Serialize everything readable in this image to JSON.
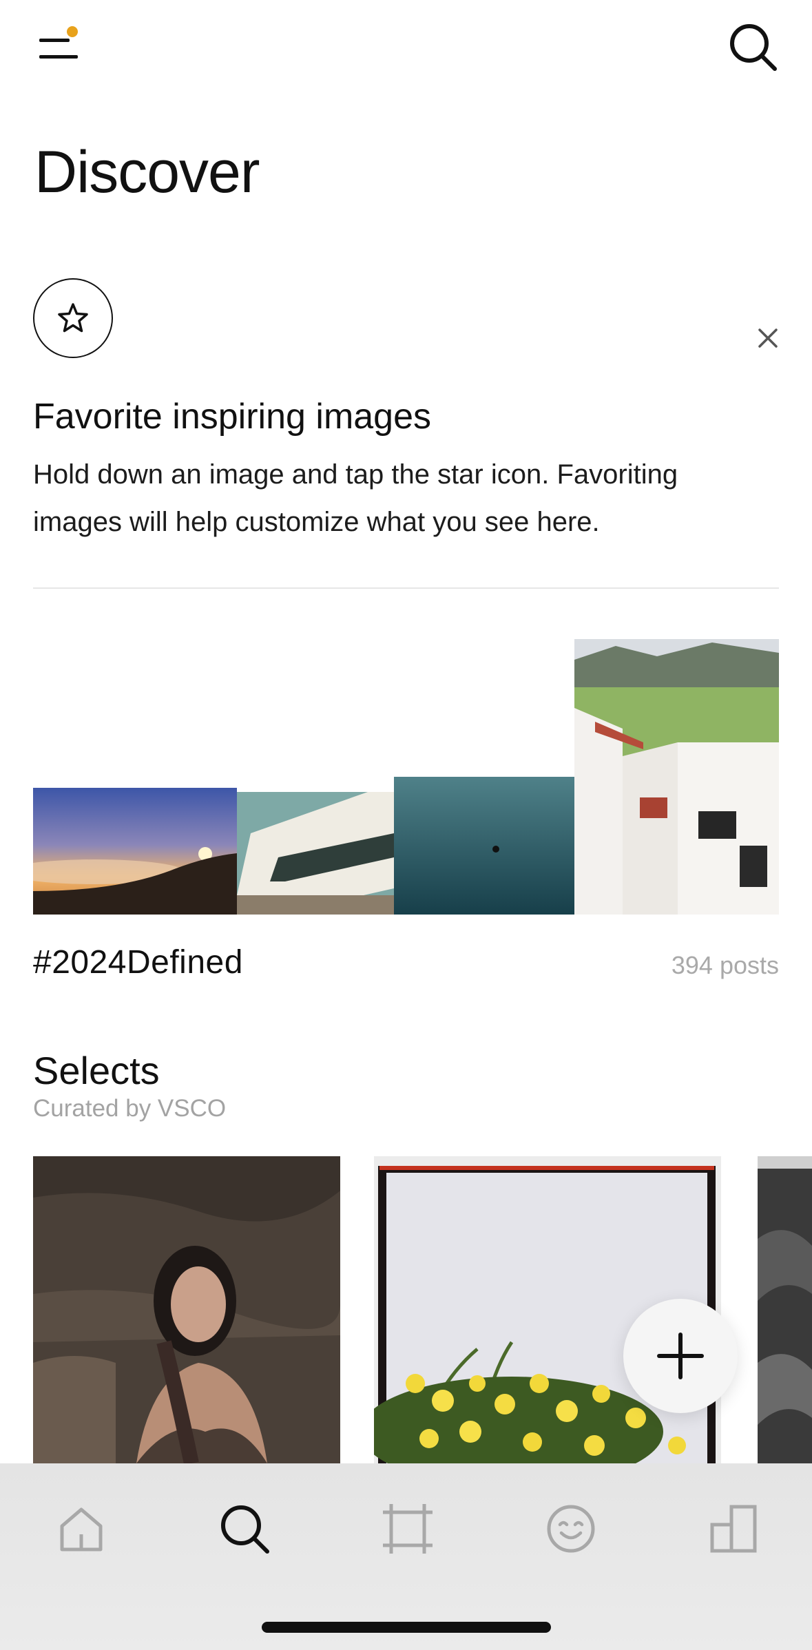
{
  "header": {
    "title": "Discover",
    "menu_icon": "menu-icon",
    "notification_dot_color": "#E8A21B",
    "search_icon": "search-icon"
  },
  "favorites_card": {
    "icon": "star-icon",
    "title": "Favorite inspiring images",
    "body": "Hold down an image and tap the star icon. Favoriting images will help customize what you see here.",
    "close_icon": "close-icon"
  },
  "collage": {
    "tag": "#2024Defined",
    "posts": "394 posts",
    "tiles": [
      {
        "name": "sunset-over-clouds",
        "colors": [
          "#4a5fa8",
          "#f0b060",
          "#3a2a20"
        ]
      },
      {
        "name": "white-building",
        "colors": [
          "#7fa8a8",
          "#f2efe6",
          "#2b3b38"
        ]
      },
      {
        "name": "ocean-water",
        "colors": [
          "#3e6f78",
          "#1e4a55"
        ]
      },
      {
        "name": "hillside-village",
        "colors": [
          "#9bbd6a",
          "#f3f1ee",
          "#b34b3b"
        ]
      }
    ]
  },
  "selects": {
    "title": "Selects",
    "subtitle": "Curated by VSCO",
    "cards": [
      {
        "name": "portrait-on-rocks"
      },
      {
        "name": "yellow-flowers-polaroid"
      },
      {
        "name": "dark-rocks"
      }
    ]
  },
  "fab": {
    "icon": "plus-icon"
  },
  "bottom_nav": {
    "items": [
      {
        "name": "home",
        "icon": "home-icon",
        "active": false
      },
      {
        "name": "search",
        "icon": "search-icon",
        "active": true
      },
      {
        "name": "editor",
        "icon": "crop-icon",
        "active": false
      },
      {
        "name": "profile",
        "icon": "smiley-icon",
        "active": false
      },
      {
        "name": "studio",
        "icon": "studio-icon",
        "active": false
      }
    ],
    "active_color": "#111111",
    "inactive_color": "#a8a8a8"
  }
}
